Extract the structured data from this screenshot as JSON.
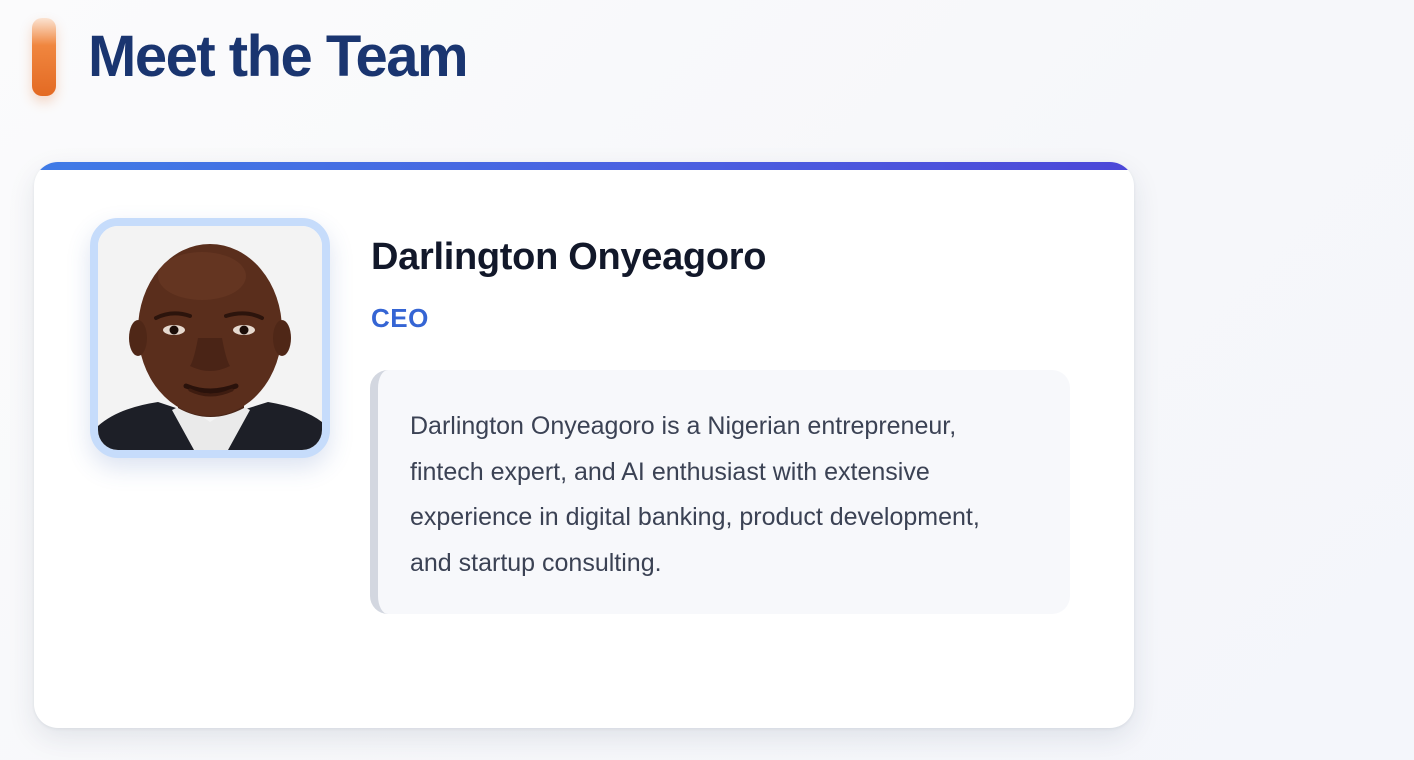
{
  "page": {
    "title": "Meet the Team",
    "colors": {
      "title": "#1a3570",
      "accent_bar": "#e36a23",
      "card_topbar_start": "#3f7be6",
      "card_topbar_end": "#4c47d8",
      "role": "#3565d4"
    }
  },
  "team": {
    "members": [
      {
        "name": "Darlington Onyeagoro",
        "role": "CEO",
        "bio": "Darlington Onyeagoro is a Nigerian entrepreneur, fintech expert, and AI enthusiast with extensive experience in digital banking, product development, and startup consulting."
      }
    ]
  }
}
